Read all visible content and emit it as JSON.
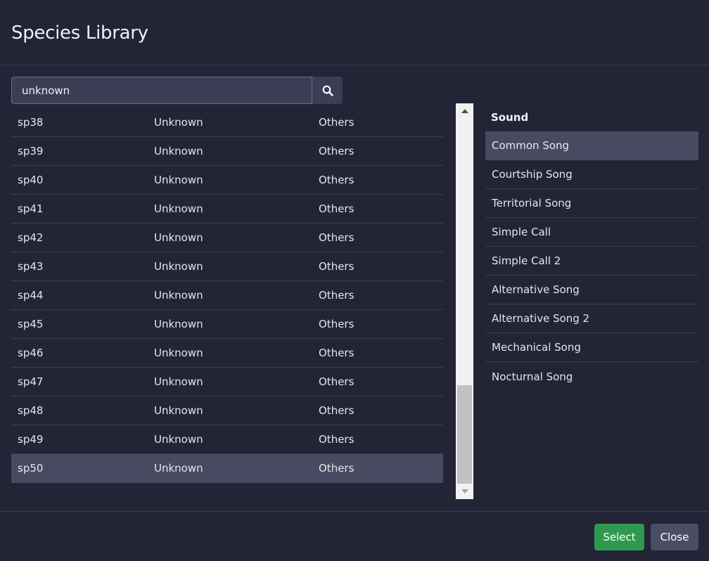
{
  "dialog": {
    "title": "Species Library"
  },
  "search": {
    "value": "unknown",
    "button_icon": "search-icon"
  },
  "species": [
    {
      "id": "sp38",
      "name": "Unknown",
      "group": "Others",
      "selected": false
    },
    {
      "id": "sp39",
      "name": "Unknown",
      "group": "Others",
      "selected": false
    },
    {
      "id": "sp40",
      "name": "Unknown",
      "group": "Others",
      "selected": false
    },
    {
      "id": "sp41",
      "name": "Unknown",
      "group": "Others",
      "selected": false
    },
    {
      "id": "sp42",
      "name": "Unknown",
      "group": "Others",
      "selected": false
    },
    {
      "id": "sp43",
      "name": "Unknown",
      "group": "Others",
      "selected": false
    },
    {
      "id": "sp44",
      "name": "Unknown",
      "group": "Others",
      "selected": false
    },
    {
      "id": "sp45",
      "name": "Unknown",
      "group": "Others",
      "selected": false
    },
    {
      "id": "sp46",
      "name": "Unknown",
      "group": "Others",
      "selected": false
    },
    {
      "id": "sp47",
      "name": "Unknown",
      "group": "Others",
      "selected": false
    },
    {
      "id": "sp48",
      "name": "Unknown",
      "group": "Others",
      "selected": false
    },
    {
      "id": "sp49",
      "name": "Unknown",
      "group": "Others",
      "selected": false
    },
    {
      "id": "sp50",
      "name": "Unknown",
      "group": "Others",
      "selected": true
    }
  ],
  "sounds": {
    "header": "Sound",
    "items": [
      {
        "label": "Common Song",
        "selected": true
      },
      {
        "label": "Courtship Song",
        "selected": false
      },
      {
        "label": "Territorial Song",
        "selected": false
      },
      {
        "label": "Simple Call",
        "selected": false
      },
      {
        "label": "Simple Call 2",
        "selected": false
      },
      {
        "label": "Alternative Song",
        "selected": false
      },
      {
        "label": "Alternative Song 2",
        "selected": false
      },
      {
        "label": "Mechanical Song",
        "selected": false
      },
      {
        "label": "Nocturnal Song",
        "selected": false
      }
    ]
  },
  "footer": {
    "select_label": "Select",
    "close_label": "Close"
  },
  "colors": {
    "background": "#232436",
    "selected_row": "#474a60",
    "select_button": "#2f9a4f",
    "close_button": "#4b4d63"
  }
}
